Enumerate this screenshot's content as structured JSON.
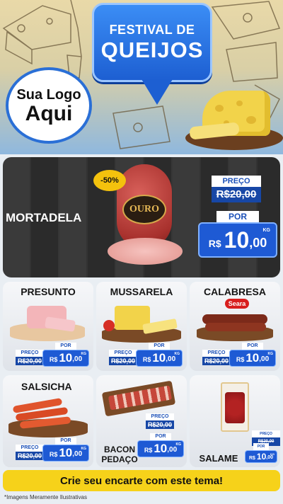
{
  "header": {
    "title_line1": "FESTIVAL DE",
    "title_line2": "QUEIJOS",
    "logo_line1": "Sua Logo",
    "logo_line2": "Aqui"
  },
  "featured": {
    "name": "MORTADELA",
    "discount": "-50%",
    "brand": "OURO",
    "preco_label": "PREÇO",
    "old_price": "R$20,00",
    "por_label": "POR",
    "currency": "R$",
    "price_int": "10",
    "price_cents": ",00",
    "unit": "KG"
  },
  "products": [
    {
      "name": "PRESUNTO",
      "preco_label": "PREÇO",
      "old_price": "R$20,00",
      "por_label": "POR",
      "currency": "R$",
      "price_int": "10",
      "price_cents": ",00",
      "unit": "KG"
    },
    {
      "name": "MUSSARELA",
      "preco_label": "PREÇO",
      "old_price": "R$20,00",
      "por_label": "POR",
      "currency": "R$",
      "price_int": "10",
      "price_cents": ",00",
      "unit": "KG"
    },
    {
      "name": "CALABRESA",
      "brand": "Seara",
      "preco_label": "PREÇO",
      "old_price": "R$20,00",
      "por_label": "POR",
      "currency": "R$",
      "price_int": "10",
      "price_cents": ",00",
      "unit": "KG"
    },
    {
      "name": "SALSICHA",
      "preco_label": "PREÇO",
      "old_price": "R$20,00",
      "por_label": "POR",
      "currency": "R$",
      "price_int": "10",
      "price_cents": ",00",
      "unit": "KG"
    },
    {
      "name_line1": "BACON",
      "name_line2": "PEDAÇO",
      "preco_label": "PREÇO",
      "old_price": "R$20,00",
      "por_label": "POR",
      "currency": "R$",
      "price_int": "10",
      "price_cents": ",00",
      "unit": "KG"
    },
    {
      "name": "SALAME",
      "preco_label": "PREÇO",
      "old_price": "R$20,00",
      "por_label": "POR",
      "currency": "R$",
      "price_int": "10",
      "price_cents": ",00",
      "unit": "KG"
    }
  ],
  "footer": {
    "cta": "Crie seu encarte com este tema!",
    "disclaimer": "*Imagens Meramente Ilustrativas"
  },
  "colors": {
    "accent_blue": "#1e5ad4",
    "cta_yellow": "#f6d21a",
    "discount_yellow": "#f4c20d"
  }
}
